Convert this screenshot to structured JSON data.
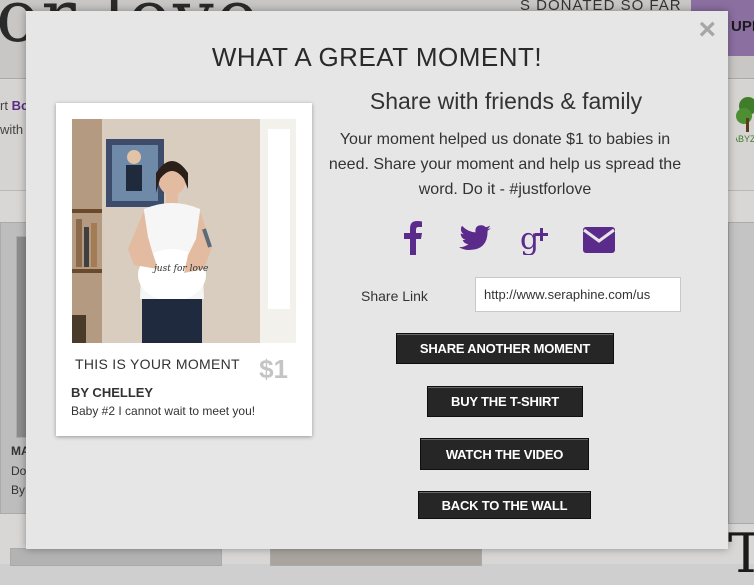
{
  "background": {
    "donated_text": "S DONATED SO FAR",
    "upload_text": "UPL",
    "strip_line1_prefix": "rt ",
    "strip_line1_bold": "Bo",
    "strip_line2": "with",
    "tree_caption": "ABYZ",
    "card_text_1": "MA",
    "card_text_2": "Do",
    "card_text_3": "By"
  },
  "modal": {
    "close_label": "×",
    "title": "WHAT A GREAT MOMENT!",
    "photo_card": {
      "label": "THIS IS YOUR MOMENT",
      "amount": "$1",
      "by": "BY CHELLEY",
      "message": "Baby #2 I cannot wait to meet you!"
    },
    "share": {
      "heading": "Share with friends & family",
      "description": "Your moment helped us donate $1 to babies in need. Share your moment and help us spread the word. Do it - #justforlove",
      "link_label": "Share Link",
      "link_value": "http://www.seraphine.com/us"
    },
    "buttons": {
      "share_another": "SHARE ANOTHER MOMENT",
      "buy_tshirt": "BUY THE T-SHIRT",
      "watch_video": "WATCH THE VIDEO",
      "back_to_wall": "BACK TO THE WALL"
    },
    "colors": {
      "social_icon": "#5b2b8c",
      "button_bg": "#262626"
    }
  }
}
